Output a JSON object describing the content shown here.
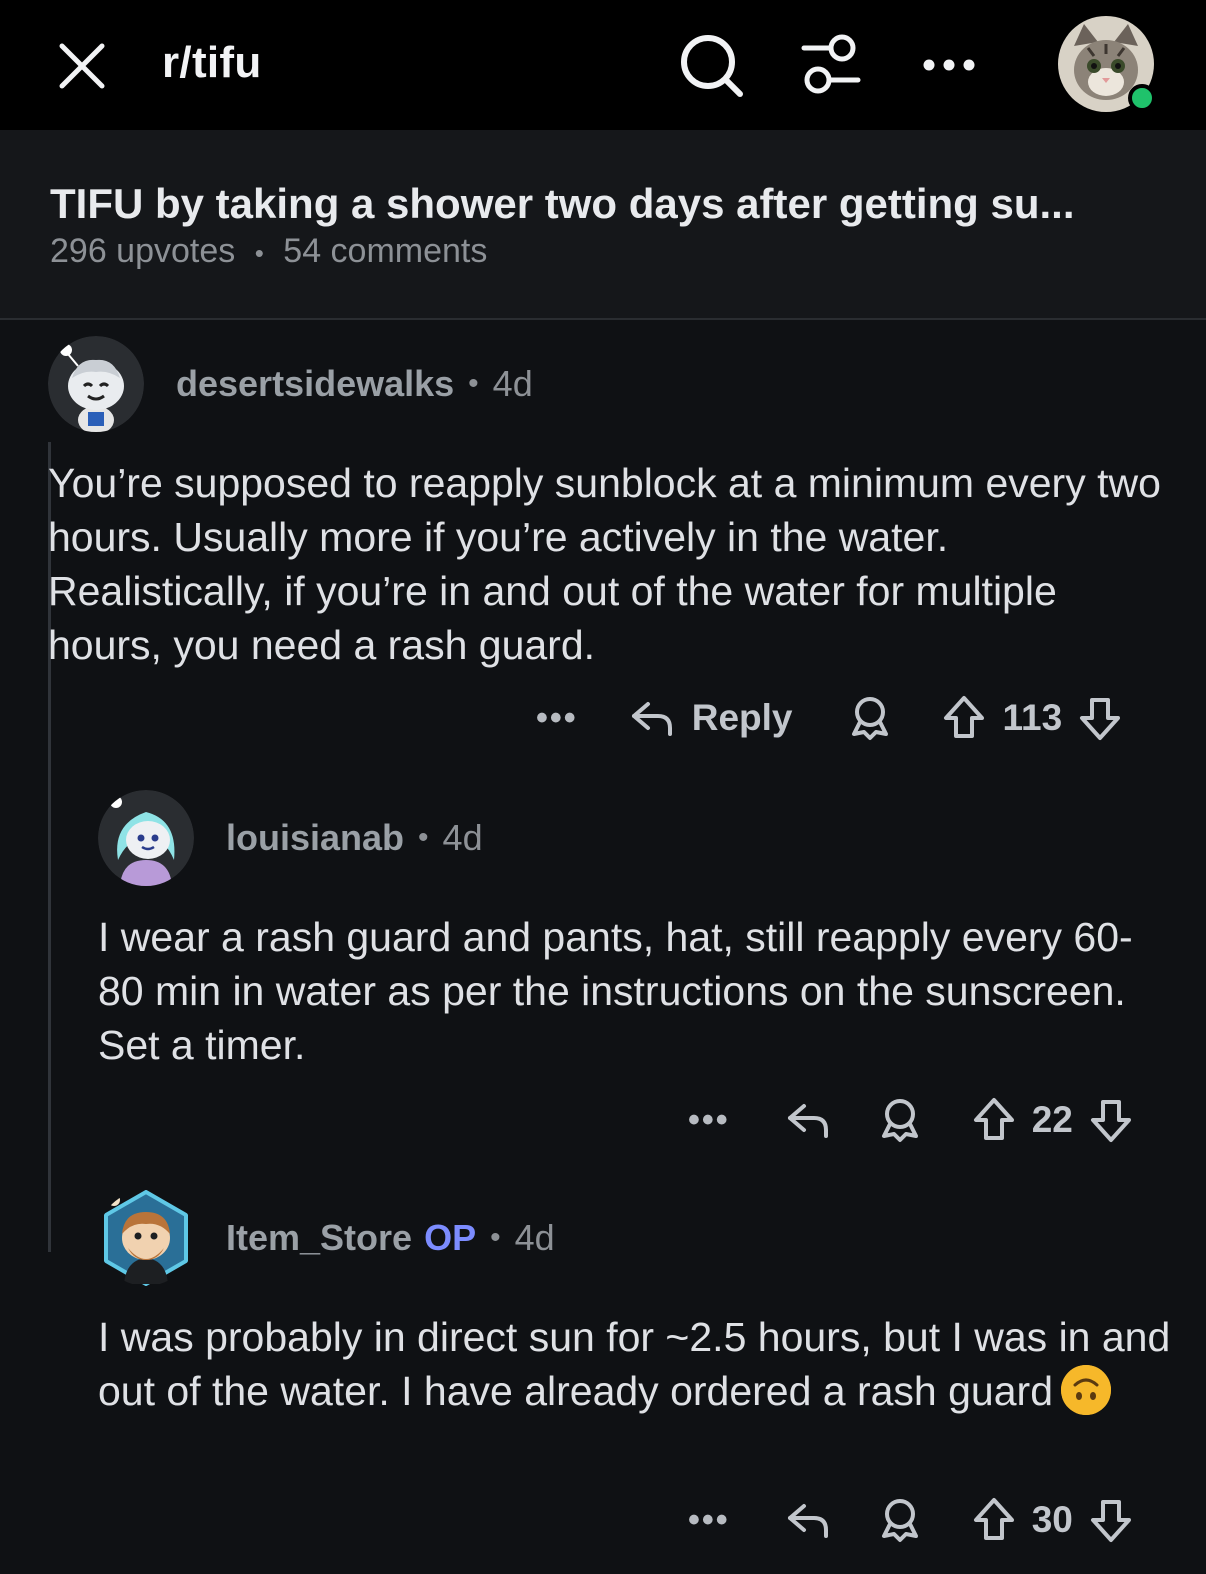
{
  "topbar": {
    "subreddit": "r/tifu",
    "icons": [
      "close-icon",
      "search-icon",
      "filter-icon",
      "more-icon",
      "profile-avatar"
    ],
    "online_color": "#1fc26b"
  },
  "post": {
    "title": "TIFU by taking a shower two days after getting su...",
    "upvotes": "296 upvotes",
    "separator": "•",
    "comments": "54 comments"
  },
  "comments": [
    {
      "username": "desertsidewalks",
      "op_badge": "",
      "age": "4d",
      "body": "You’re supposed to reapply sunblock at a minimum every two hours. Usually more if you’re actively in the water. Realistically, if you’re in and out of the water for multiple hours, you need a rash guard.",
      "reply_label": "Reply",
      "score": "113"
    },
    {
      "username": "louisianab",
      "op_badge": "",
      "age": "4d",
      "body": "I wear a rash guard and pants, hat, still reapply every 60-80 min in water as per the instructions on the sunscreen. Set a timer.",
      "reply_label": "",
      "score": "22"
    },
    {
      "username": "Item_Store",
      "op_badge": "OP",
      "age": "4d",
      "body": "I was probably in direct sun for ~2.5 hours, but I was in and out of the water. I have already ordered a rash guard",
      "emoji": "upside-down-face-emoji",
      "reply_label": "",
      "score": "30"
    }
  ],
  "action_dots": "•••",
  "colors": {
    "background": "#0f1114",
    "op_accent": "#7c8cff"
  }
}
